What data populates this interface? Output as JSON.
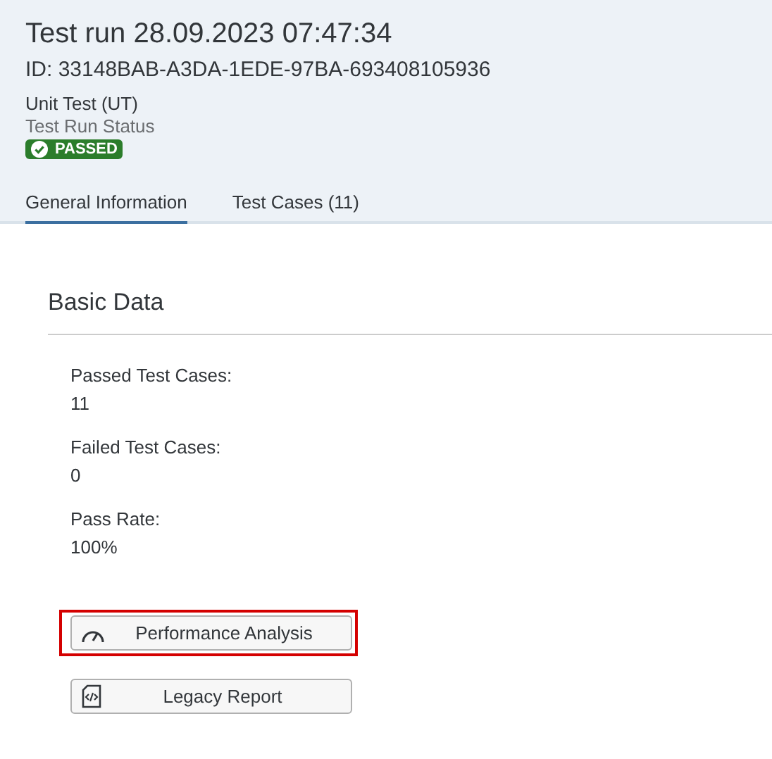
{
  "header": {
    "title": "Test run 28.09.2023 07:47:34",
    "id": "ID: 33148BAB-A3DA-1EDE-97BA-693408105936",
    "type": "Unit Test (UT)",
    "status_label": "Test Run Status",
    "status": {
      "text": "PASSED",
      "kind": "success"
    }
  },
  "tabs": [
    {
      "label": "General Information",
      "selected": true
    },
    {
      "label": "Test Cases (11)",
      "selected": false
    }
  ],
  "section": {
    "title": "Basic Data",
    "fields": [
      {
        "label": "Passed Test Cases:",
        "value": "11"
      },
      {
        "label": "Failed Test Cases:",
        "value": "0"
      },
      {
        "label": "Pass Rate:",
        "value": "100%"
      }
    ]
  },
  "buttons": [
    {
      "label": "Performance Analysis",
      "kind": "gauge",
      "highlighted": true
    },
    {
      "label": "Legacy Report",
      "kind": "code",
      "highlighted": false
    }
  ]
}
